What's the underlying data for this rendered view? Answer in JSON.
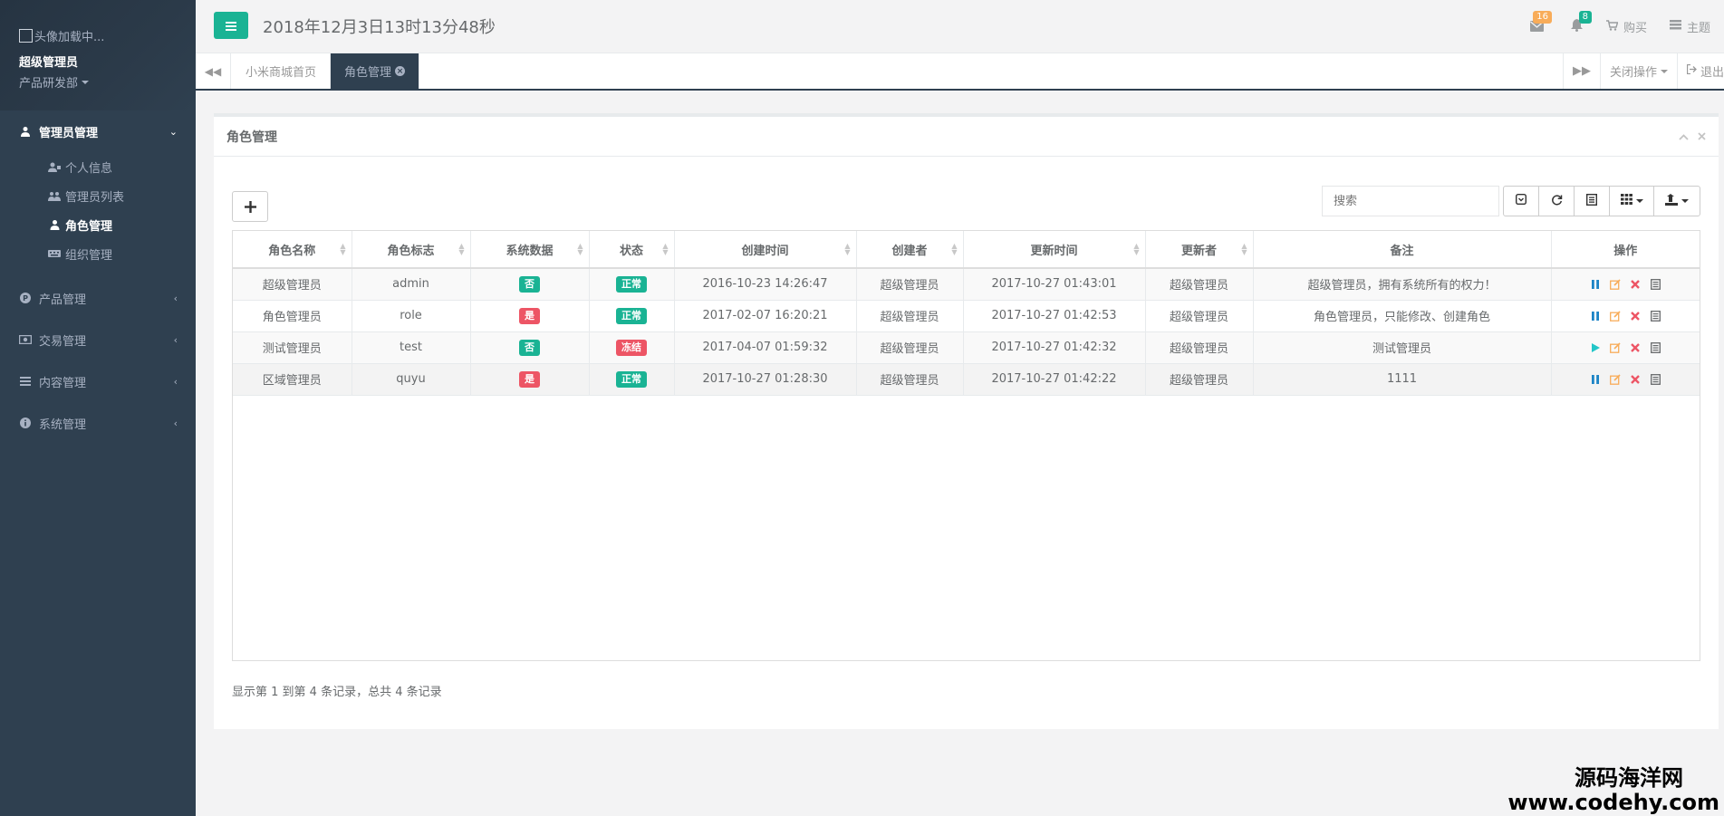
{
  "profile": {
    "avatar_text": "头像加载中...",
    "name": "超级管理员",
    "department": "产品研发部"
  },
  "sidebar": {
    "sections": [
      {
        "label": "管理员管理",
        "icon": "user-icon",
        "active": true,
        "children": [
          {
            "label": "个人信息",
            "icon": "user-card-icon"
          },
          {
            "label": "管理员列表",
            "icon": "users-icon"
          },
          {
            "label": "角色管理",
            "icon": "user-role-icon",
            "current": true
          },
          {
            "label": "组织管理",
            "icon": "keyboard-icon"
          }
        ]
      },
      {
        "label": "产品管理",
        "icon": "product-icon"
      },
      {
        "label": "交易管理",
        "icon": "money-icon"
      },
      {
        "label": "内容管理",
        "icon": "list-icon"
      },
      {
        "label": "系统管理",
        "icon": "info-icon"
      }
    ]
  },
  "header": {
    "datetime": "2018年12月3日13时13分48秒",
    "mail_count": "16",
    "bell_count": "8",
    "buy_label": "购买",
    "theme_label": "主题"
  },
  "tabs": {
    "items": [
      {
        "label": "小米商城首页",
        "active": false
      },
      {
        "label": "角色管理",
        "active": true
      }
    ],
    "close_ops_label": "关闭操作",
    "logout_label": "退出"
  },
  "panel": {
    "title": "角色管理",
    "search_placeholder": "搜索"
  },
  "table": {
    "columns": [
      "角色名称",
      "角色标志",
      "系统数据",
      "状态",
      "创建时间",
      "创建者",
      "更新时间",
      "更新者",
      "备注",
      "操作"
    ],
    "rows": [
      {
        "name": "超级管理员",
        "key": "admin",
        "system": "否",
        "status": "正常",
        "created": "2016-10-23 14:26:47",
        "creator": "超级管理员",
        "updated": "2017-10-27 01:43:01",
        "updater": "超级管理员",
        "remark": "超级管理员，拥有系统所有的权力！",
        "toggle": "pause"
      },
      {
        "name": "角色管理员",
        "key": "role",
        "system": "是",
        "status": "正常",
        "created": "2017-02-07 16:20:21",
        "creator": "超级管理员",
        "updated": "2017-10-27 01:42:53",
        "updater": "超级管理员",
        "remark": "角色管理员，只能修改、创建角色",
        "toggle": "pause"
      },
      {
        "name": "测试管理员",
        "key": "test",
        "system": "否",
        "status": "冻结",
        "created": "2017-04-07 01:59:32",
        "creator": "超级管理员",
        "updated": "2017-10-27 01:42:32",
        "updater": "超级管理员",
        "remark": "测试管理员",
        "toggle": "play"
      },
      {
        "name": "区域管理员",
        "key": "quyu",
        "system": "是",
        "status": "正常",
        "created": "2017-10-27 01:28:30",
        "creator": "超级管理员",
        "updated": "2017-10-27 01:42:22",
        "updater": "超级管理员",
        "remark": "1111",
        "toggle": "pause"
      }
    ]
  },
  "pager": {
    "info": "显示第 1 到第 4 条记录，总共 4 条记录"
  },
  "watermark": {
    "cn": "源码海洋网",
    "url": "www.codehy.com"
  },
  "colors": {
    "sidebar_bg": "#2f4050",
    "primary": "#1ab394",
    "danger": "#ed5565",
    "warning": "#f8ac59"
  }
}
